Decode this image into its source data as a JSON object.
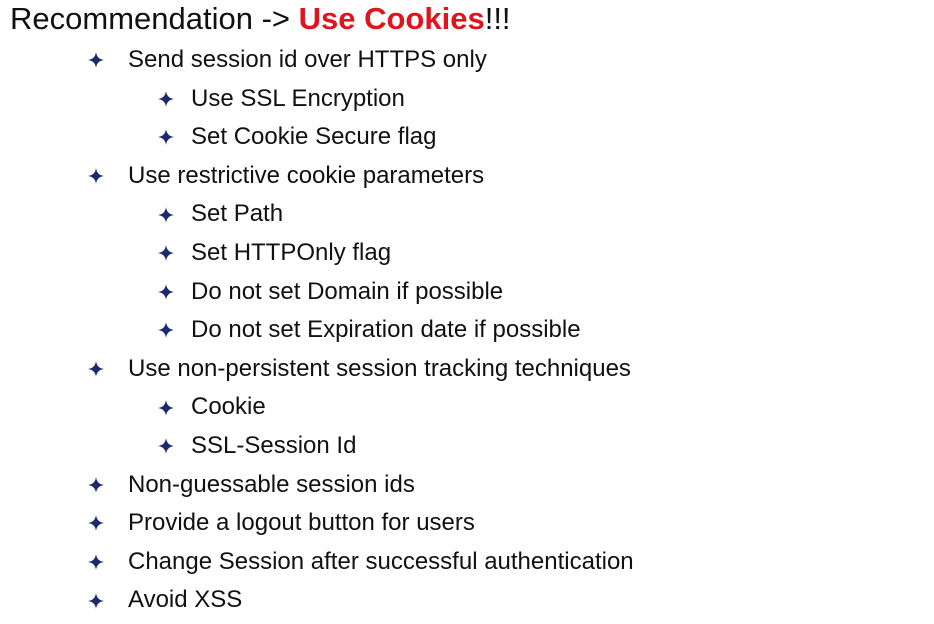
{
  "slide": {
    "title_prefix": "Recommendation -> ",
    "title_highlight": "Use Cookies",
    "title_suffix": "!!!",
    "accent_color": "#e0141c",
    "bullet_color": "#1a2a6c",
    "bullet_icon": "four-point-star-icon",
    "items": [
      {
        "level": 1,
        "text": "Send session id over HTTPS only"
      },
      {
        "level": 2,
        "text": "Use SSL Encryption"
      },
      {
        "level": 2,
        "text": "Set Cookie Secure flag"
      },
      {
        "level": 1,
        "text": "Use restrictive cookie parameters"
      },
      {
        "level": 2,
        "text": "Set Path"
      },
      {
        "level": 2,
        "text": "Set HTTPOnly flag"
      },
      {
        "level": 2,
        "text": "Do not set Domain if possible"
      },
      {
        "level": 2,
        "text": "Do not set Expiration date if possible"
      },
      {
        "level": 1,
        "text": "Use non-persistent session tracking techniques"
      },
      {
        "level": 2,
        "text": "Cookie"
      },
      {
        "level": 2,
        "text": "SSL-Session Id"
      },
      {
        "level": 1,
        "text": "Non-guessable session ids"
      },
      {
        "level": 1,
        "text": "Provide a logout button for users"
      },
      {
        "level": 1,
        "text": "Change Session after successful authentication"
      },
      {
        "level": 1,
        "text": "Avoid XSS"
      }
    ]
  }
}
